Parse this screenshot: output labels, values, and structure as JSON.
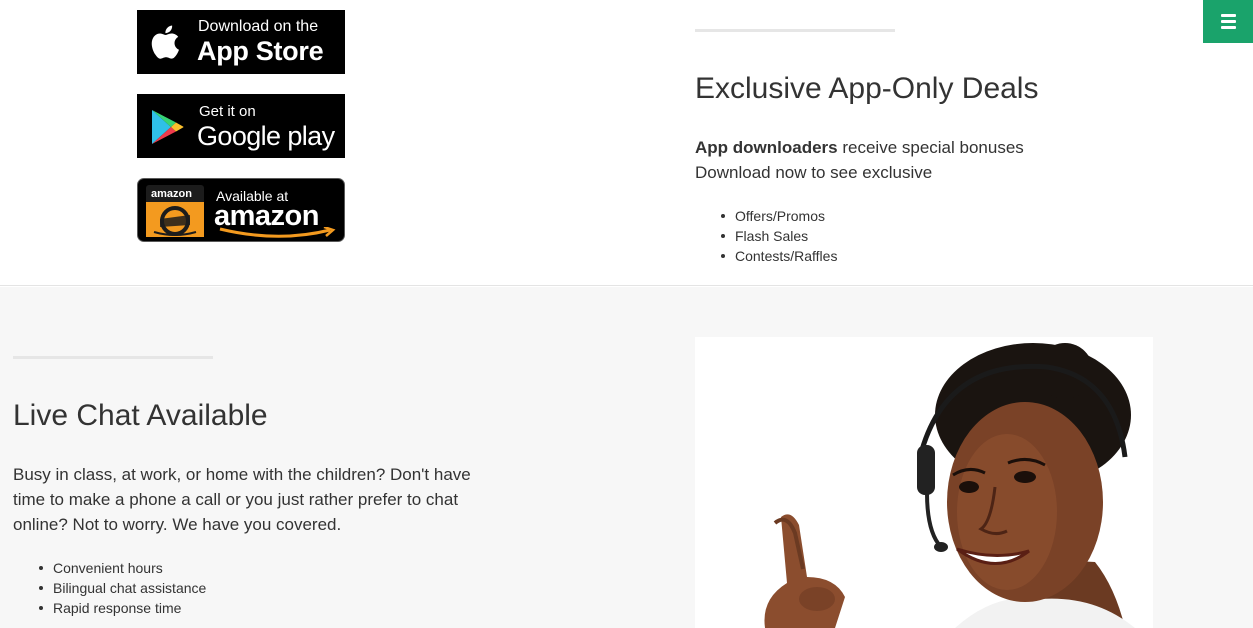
{
  "menu": {
    "icon": "hamburger-menu-icon",
    "color": "#1aa36b"
  },
  "badges": {
    "appstore": {
      "small": "Download on the",
      "big": "App Store",
      "icon": "apple-icon"
    },
    "google": {
      "small": "Get it on",
      "big": "Google play",
      "icon": "google-play-icon"
    },
    "amazon": {
      "logo_text": "amazon",
      "small": "Available at",
      "big": "amazon",
      "icon": "amazon-appstore-icon"
    }
  },
  "deals": {
    "title": "Exclusive App-Only Deals",
    "intro_bold": "App downloaders",
    "intro_rest": " receive special bonuses",
    "line2": "Download now to see exclusive",
    "items": [
      "Offers/Promos",
      "Flash Sales",
      "Contests/Raffles"
    ]
  },
  "chat": {
    "title": "Live Chat Available",
    "description": "Busy in class, at work, or home with the children? Don't have time to make a phone a call or you just rather prefer to chat online? Not to worry. We have you covered.",
    "items": [
      "Convenient hours",
      "Bilingual chat assistance",
      "Rapid response time"
    ],
    "image": "support-agent-headset-photo"
  }
}
